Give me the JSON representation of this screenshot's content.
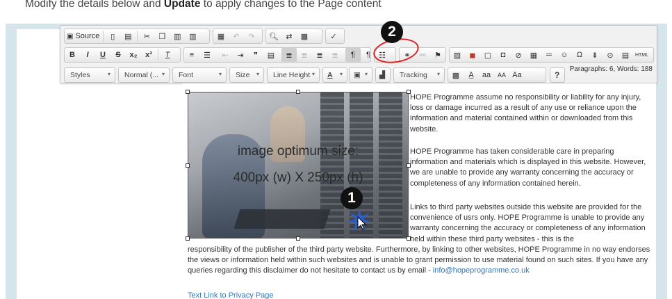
{
  "intro": {
    "before": "Modify the details below and ",
    "bold": "Update",
    "after": " to apply changes to the Page content"
  },
  "toolbar": {
    "row1": {
      "source_label": "Source",
      "icons": [
        "new-page-icon",
        "templates-icon",
        "cut-icon",
        "copy-icon",
        "paste-icon",
        "paste-text-icon",
        "paste-word-icon",
        "undo-icon",
        "redo-icon",
        "find-icon",
        "replace-icon",
        "select-all-icon",
        "spellcheck-icon"
      ]
    },
    "row2": {
      "format": [
        "B",
        "I",
        "U",
        "S",
        "x₂",
        "x²",
        "Ix"
      ],
      "icons": [
        "numbered-list-icon",
        "bullet-list-icon",
        "outdent-icon",
        "indent-icon",
        "blockquote-icon",
        "div-icon",
        "align-left-icon",
        "align-center-icon",
        "align-right-icon",
        "justify-icon",
        "ltr-icon",
        "rtl-icon",
        "paragraph-style-icon",
        "link-icon",
        "unlink-icon",
        "anchor-icon",
        "image-icon",
        "flash-icon",
        "iframe-icon",
        "html5-video-icon",
        "no-entry-icon",
        "table-icon",
        "horizontal-line-icon",
        "smiley-icon",
        "special-char-icon",
        "map-icon",
        "page-break-icon",
        "html-icon"
      ]
    },
    "row3": {
      "styles": "Styles",
      "format": "Normal (...",
      "font": "Font",
      "size": "Size",
      "line_height": "Line Height",
      "text_color": "A",
      "tracking": "Tracking",
      "help": "?",
      "case_samples": [
        "aa",
        "AA",
        "Aa"
      ]
    },
    "status": "Paragraphs: 6, Words: 188"
  },
  "image": {
    "caption_line1": "image optimum size:",
    "caption_line2": "400px (w) X 250px (h)"
  },
  "annotations": {
    "step1": "1",
    "step2": "2"
  },
  "content": {
    "p1": "HOPE Programme assume no responsibility or liability for any injury, loss or damage incurred as a result of any use or reliance upon the information and material contained within or downloaded from this website.",
    "p2": "HOPE Programme has taken considerable care in preparing information and materials which is displayed in this website. However, we are unable to provide any warranty concerning the accuracy or completeness of any information contained herein.",
    "p3a": "Links to third party websites outside this website are provided for the convenience of usrs only. HOPE Programme is unable to provide any warranty concerning the accuracy or completeness of any information held within these third party websites - this is the",
    "p3b": "responsibility of the publisher of the third party website. Furthermore, by linking to other websites, HOPE Programme in no way endorses the views or information held within such websites and is unable to grant permission to use material found on such sites. If you have any queries regarding this disclaimer do not hesitate to contact us by email - ",
    "email": "info@hopeprogramme.co.uk",
    "privacy_link": "Text Link to Privacy Page"
  },
  "colors": {
    "accent_link": "#2f75b5",
    "frame": "#d6e4ec",
    "annotation_ring": "#e02020"
  }
}
